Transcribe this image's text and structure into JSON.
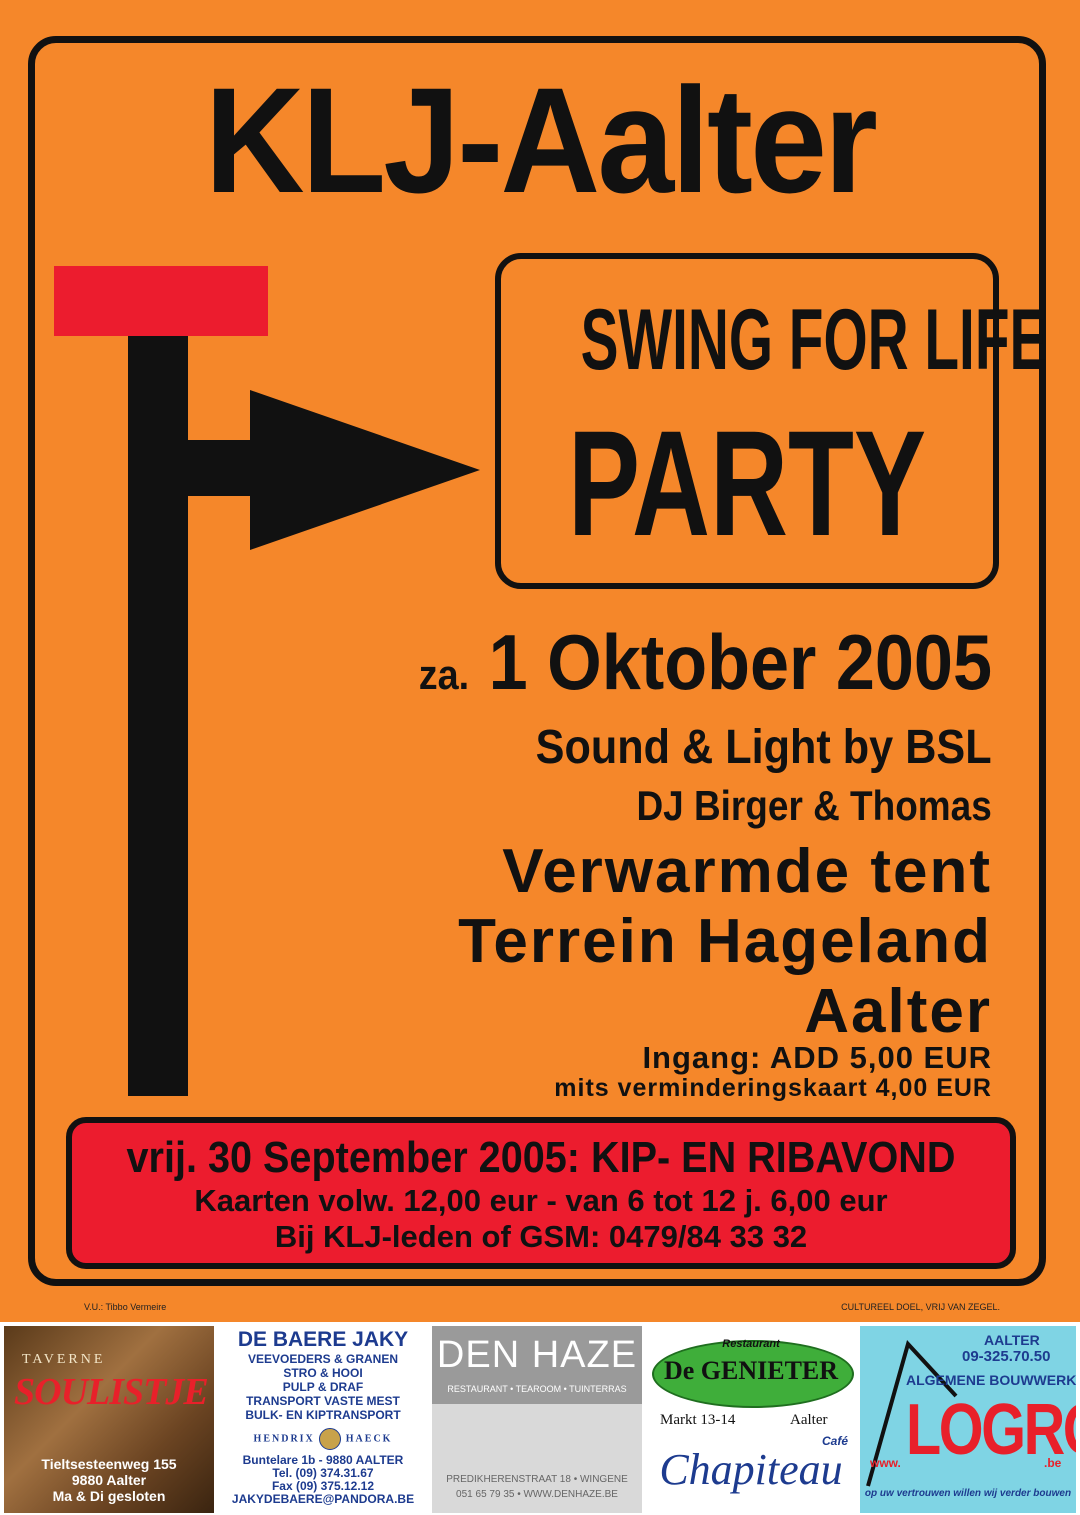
{
  "poster": {
    "title": "KLJ-Aalter",
    "event_line1": "SWING FOR LIFE",
    "event_line2": "PARTY",
    "day_prefix": "za.",
    "date": "1 Oktober 2005",
    "sound": "Sound & Light by BSL",
    "dj": "DJ Birger & Thomas",
    "venue1": "Verwarmde tent",
    "venue2": "Terrein Hageland",
    "venue3": "Aalter",
    "entry": "Ingang: ADD 5,00 EUR",
    "discount": "mits verminderingskaart 4,00 EUR",
    "ribavond_line1": "vrij. 30 September 2005: KIP- EN RIBAVOND",
    "ribavond_line2": "Kaarten volw. 12,00 eur - van 6 tot 12 j. 6,00 eur",
    "ribavond_line3": "Bij KLJ-leden of GSM: 0479/84 33 32",
    "vu": "V.U.: Tibbo Vermeire",
    "cultural": "CULTUREEL DOEL, VRIJ VAN ZEGEL.",
    "colors": {
      "background": "#F5872A",
      "red": "#EC1C2E",
      "ink": "#111111"
    }
  },
  "ads": {
    "soulistje": {
      "top": "TAVERNE",
      "name": "SOULISTJE",
      "addr1": "Tieltsesteenweg 155",
      "addr2": "9880 Aalter",
      "note": "Ma & Di gesloten"
    },
    "debaere": {
      "name": "DE BAERE JAKY",
      "lines": [
        "VEEVOEDERS & GRANEN",
        "STRO & HOOI",
        "PULP & DRAF",
        "TRANSPORT VASTE MEST",
        "BULK- EN KIPTRANSPORT"
      ],
      "brand_left": "HENDRIX",
      "brand_right": "HAECK",
      "addr": "Buntelare 1b - 9880 AALTER",
      "tel": "Tel. (09) 374.31.67",
      "fax": "Fax (09) 375.12.12",
      "email": "JAKYDEBAERE@PANDORA.BE"
    },
    "denhaze": {
      "name": "DEN HAZE",
      "tagline": "RESTAURANT • TEAROOM • TUINTERRAS",
      "addr": "PREDIKHERENSTRAAT 18 • WINGENE",
      "contact": "051 65 79 35 • WWW.DENHAZE.BE"
    },
    "genieter": {
      "label": "Restaurant",
      "name": "De GENIETER",
      "addr": "Markt 13-14",
      "town": "Aalter",
      "cafe": "Café",
      "cafe_name": "Chapiteau"
    },
    "logro": {
      "town": "AALTER",
      "phone": "09-325.70.50",
      "service": "ALGEMENE BOUWWERKEN",
      "www": "www.",
      "name": "LOGRO",
      "tld": ".be",
      "slogan": "op uw vertrouwen willen wij verder bouwen"
    }
  }
}
